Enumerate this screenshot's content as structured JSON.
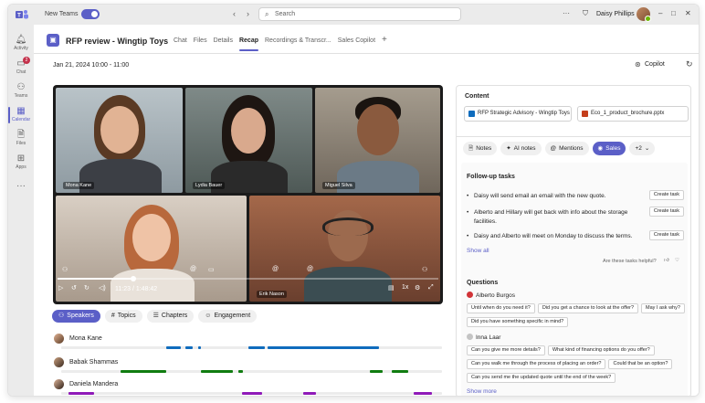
{
  "titlebar": {
    "new_teams_label": "New Teams",
    "search_placeholder": "Search",
    "more": "···",
    "user_name": "Daisy Phillips",
    "nav_back": "‹",
    "nav_forward": "›",
    "minimize": "–",
    "maximize": "□",
    "close": "✕"
  },
  "appbar": {
    "items": [
      {
        "label": "Activity",
        "icon": "bell-icon"
      },
      {
        "label": "Chat",
        "icon": "chat-icon",
        "badge": "2"
      },
      {
        "label": "Teams",
        "icon": "teams-icon"
      },
      {
        "label": "Calendar",
        "icon": "calendar-icon"
      },
      {
        "label": "Files",
        "icon": "files-icon"
      },
      {
        "label": "Apps",
        "icon": "apps-icon"
      }
    ],
    "more": "···"
  },
  "header": {
    "title": "RFP review - Wingtip Toys",
    "tabs": [
      "Chat",
      "Files",
      "Details",
      "Recap",
      "Recordings & Transcr...",
      "Sales Copilot"
    ],
    "active_tab": "Recap",
    "add": "+"
  },
  "subheader": {
    "date": "Jan 21, 2024 10:00 - 11:00",
    "copilot_label": "Copilot"
  },
  "video": {
    "participants": [
      "Mona Kane",
      "Lydia Bauer",
      "Miguel Silva",
      "",
      "Erik Nason"
    ],
    "progress": 0.2,
    "time": "11:23 / 1:48:42",
    "accent": "#5b5fc7"
  },
  "filters": [
    "Speakers",
    "Topics",
    "Chapters",
    "Engagement"
  ],
  "speakers": [
    {
      "name": "Mona Kane",
      "color": "#0f6cbd"
    },
    {
      "name": "Babak Shammas",
      "color": "#107c10"
    },
    {
      "name": "Daniela Mandera",
      "color": "#8f1ab8"
    }
  ],
  "panel": {
    "content_label": "Content",
    "files": [
      "RFP Strategic Advisory - Wingtip Toys",
      "Eco_1_product_brochure.pptx"
    ],
    "tabs": [
      "Notes",
      "AI notes",
      "Mentions",
      "Sales",
      "+2"
    ],
    "active_tab": "Sales",
    "followup_label": "Follow-up tasks",
    "tasks": [
      "Daisy will send email an email with the new quote.",
      "Alberto and Hillary will get back with info about the storage facilities.",
      "Daisy and Alberto will meet on Monday to discuss the terms."
    ],
    "create_task_label": "Create task",
    "show_all": "Show all",
    "helpful_prompt": "Are these tasks helpful?",
    "questions_label": "Questions",
    "question_groups": [
      {
        "person": "Alberto Burgos",
        "questions": [
          "Until when do you need it?",
          "Did you get a chance to look at the offer?",
          "May I ask why?",
          "Did you have something specific in mind?"
        ]
      },
      {
        "person": "Inna Laar",
        "questions": [
          "Can you give me more details?",
          "What kind of financing options do you offer?",
          "Can you walk me through the process of placing an order?",
          "Could that be an option?",
          "Can you send me the updated quote until the end of the week?"
        ]
      }
    ],
    "show_more": "Show more"
  }
}
